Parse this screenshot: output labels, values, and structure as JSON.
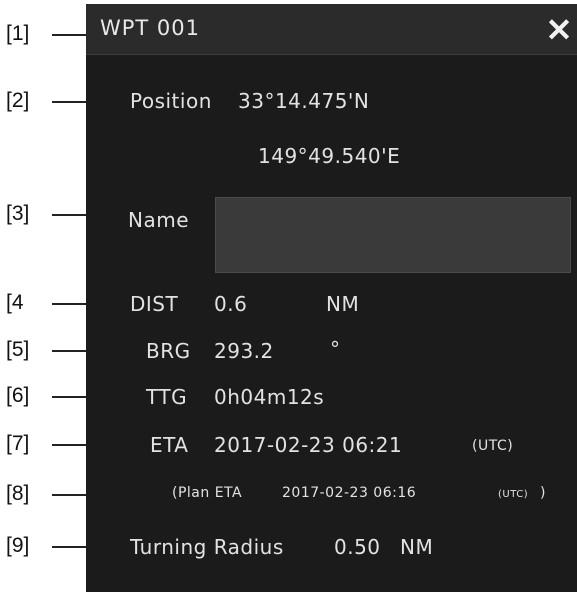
{
  "callouts": [
    "[1]",
    "[2]",
    "[3]",
    "[4",
    "[5]",
    "[6]",
    "[7]",
    "[8]",
    "[9]"
  ],
  "panel": {
    "title": "WPT 001",
    "close_glyph": "✕",
    "position": {
      "label": "Position",
      "lat": "33°14.475'N",
      "lon": "149°49.540'E"
    },
    "name": {
      "label": "Name",
      "value": ""
    },
    "dist": {
      "label": "DIST",
      "value": "0.6",
      "unit": "NM"
    },
    "brg": {
      "label": "BRG",
      "value": "293.2",
      "unit": "°"
    },
    "ttg": {
      "label": "TTG",
      "value": "0h04m12s"
    },
    "eta": {
      "label": "ETA",
      "value": "2017-02-23 06:21",
      "tz": "(UTC)"
    },
    "plan_eta": {
      "prefix": "(Plan ETA",
      "value": "2017-02-23 06:16",
      "tz": "(UTC)",
      "suffix": ")"
    },
    "turning_radius": {
      "label": "Turning Radius",
      "value": "0.50",
      "unit": "NM"
    }
  },
  "colors": {
    "panel_bg": "#1b1b1b",
    "titlebar_bg": "#2b2b2b",
    "text": "#e2e2e2",
    "input_bg": "#3a3a3a"
  }
}
